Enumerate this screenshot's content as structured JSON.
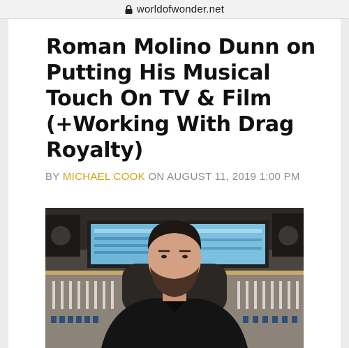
{
  "browser": {
    "url": "worldofwonder.net"
  },
  "article": {
    "title": "Roman Molino Dunn on Putting His Musical Touch On TV & Film (+Working With Drag Royalty)",
    "byline_prefix": "BY ",
    "author": "MICHAEL COOK",
    "byline_on": " ON ",
    "date": "AUGUST 11, 2019 1:00 PM"
  },
  "colors": {
    "author_link": "#d4a106",
    "byline_text": "#8c8c8c",
    "title_text": "#111111"
  }
}
